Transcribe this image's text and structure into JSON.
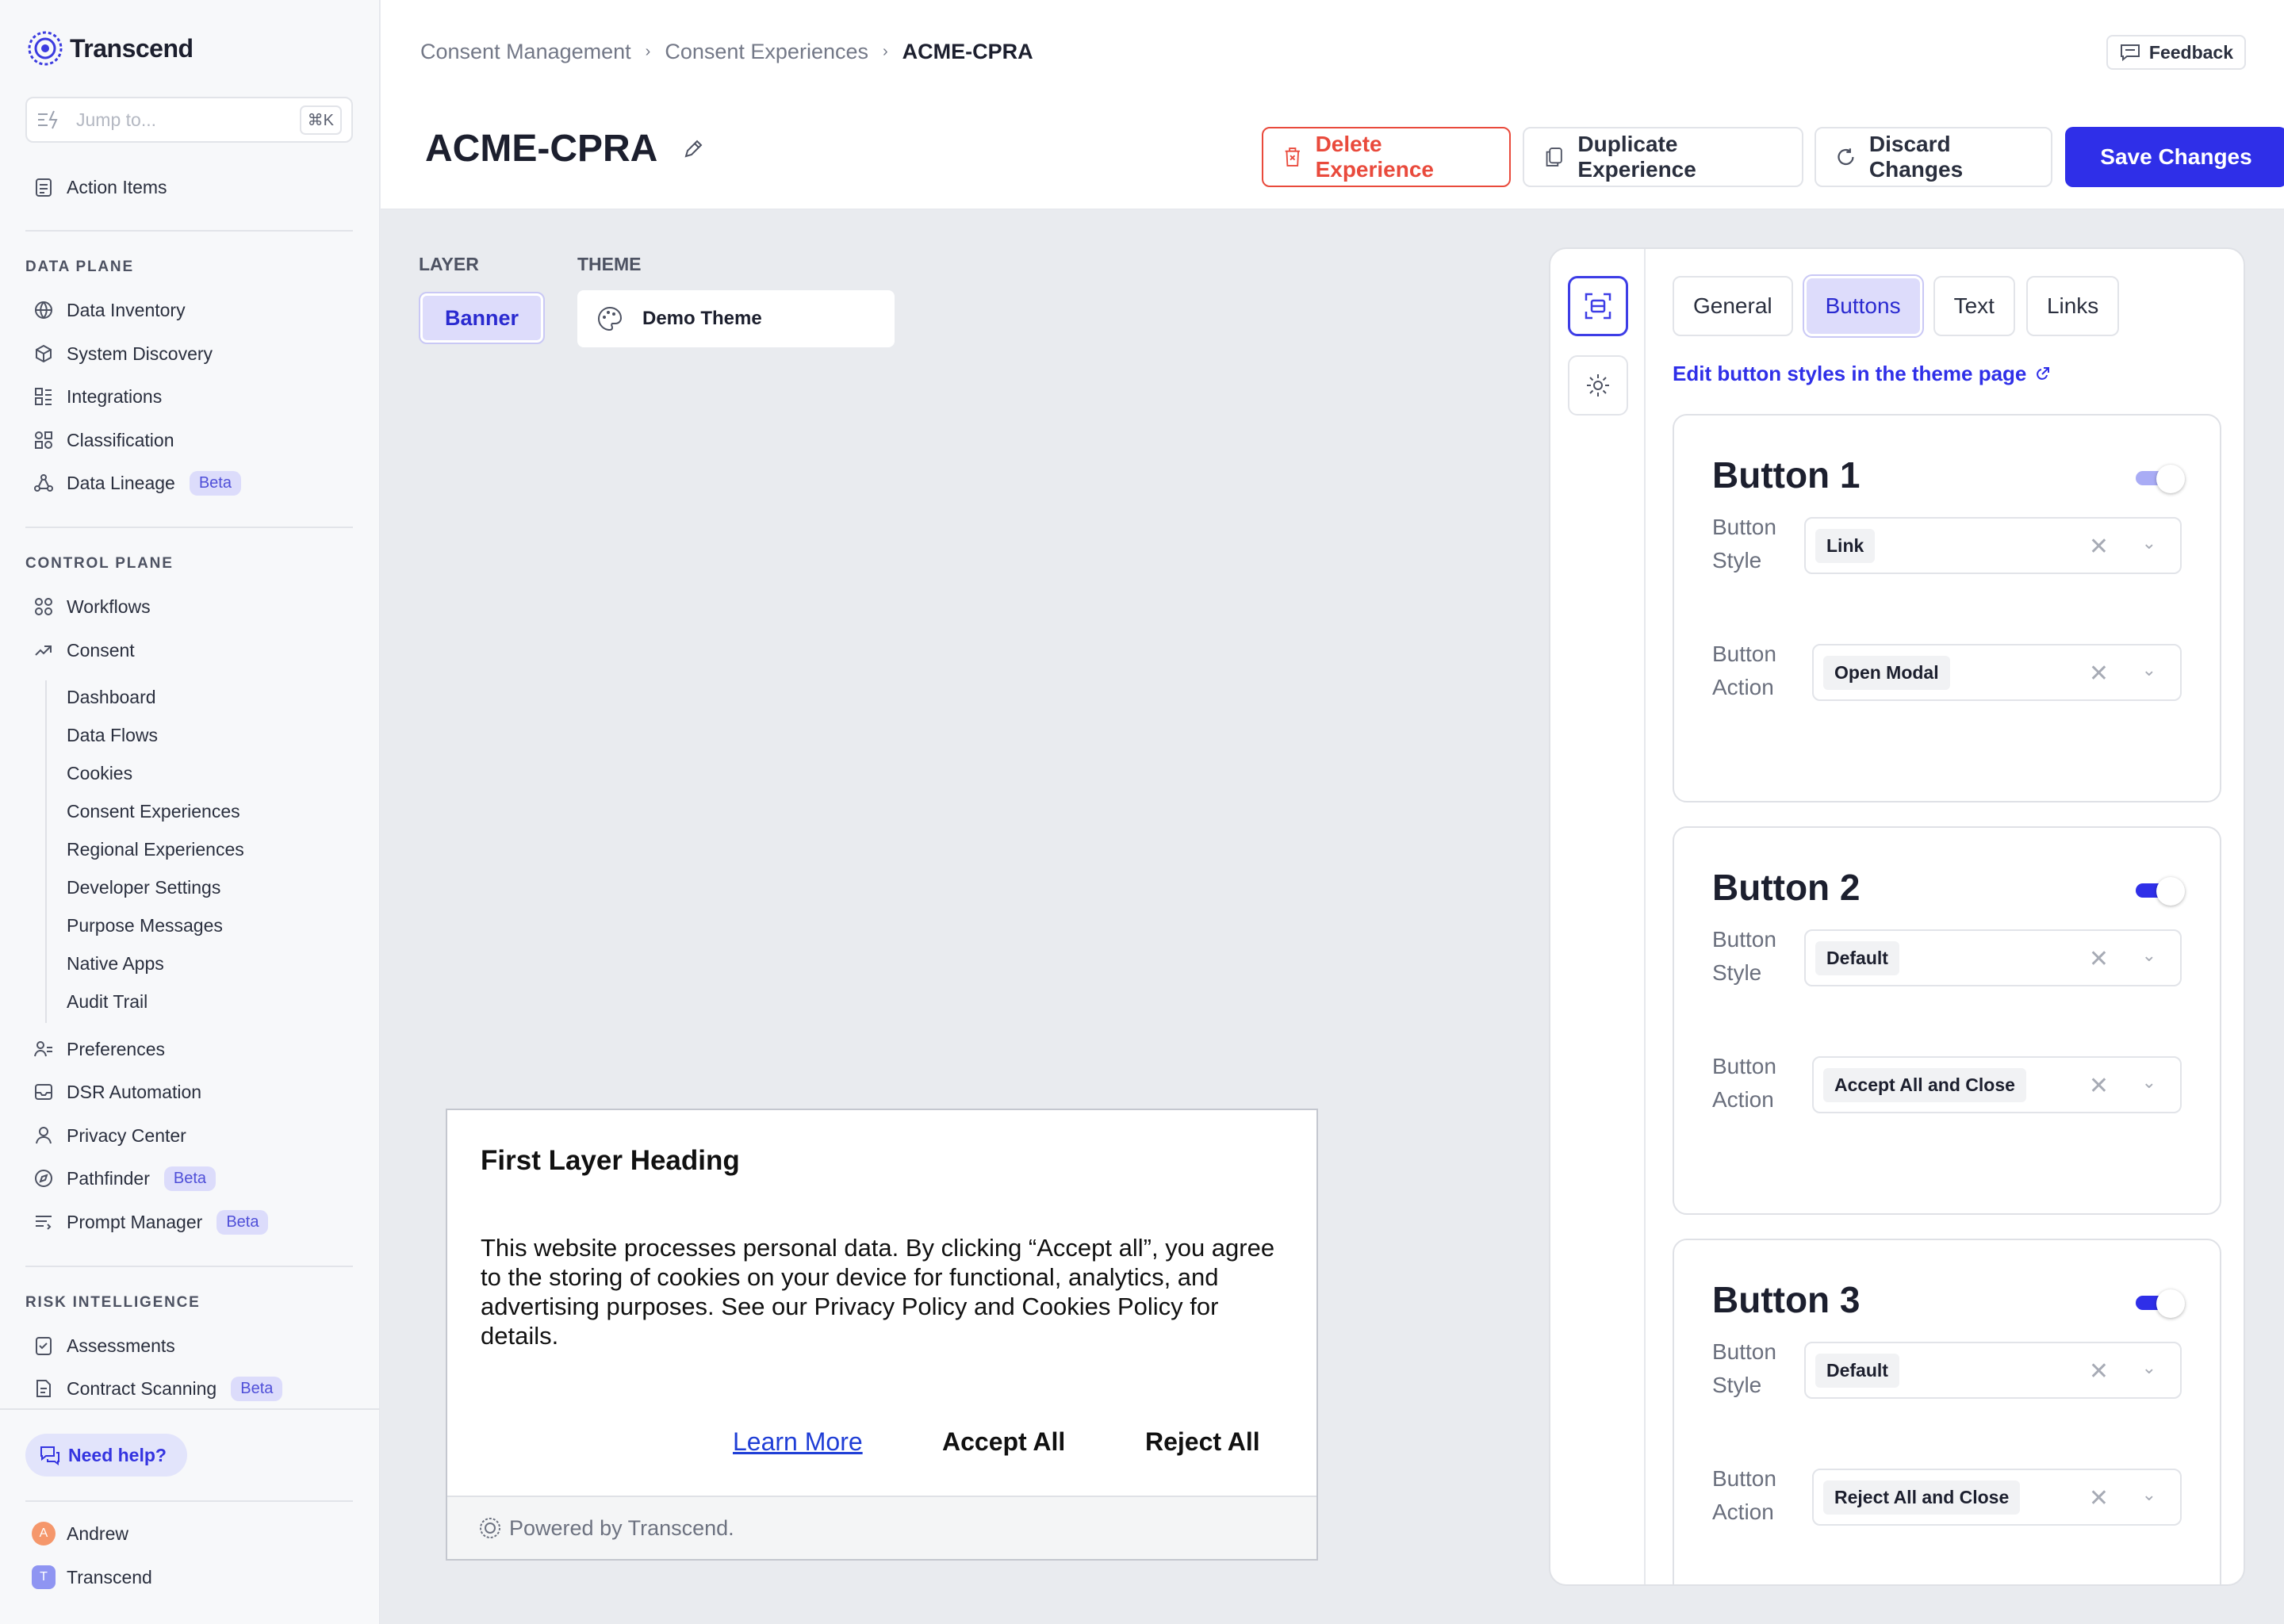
{
  "app": {
    "name": "Transcend"
  },
  "sidebar": {
    "jump_placeholder": "Jump to...",
    "jump_shortcut": "⌘K",
    "action_items": "Action Items",
    "data_plane": {
      "title": "DATA PLANE",
      "items": [
        {
          "label": "Data Inventory",
          "icon": "globe-icon"
        },
        {
          "label": "System Discovery",
          "icon": "cube-icon"
        },
        {
          "label": "Integrations",
          "icon": "integrations-icon"
        },
        {
          "label": "Classification",
          "icon": "classification-icon"
        },
        {
          "label": "Data Lineage",
          "icon": "lineage-icon",
          "badge": "Beta"
        }
      ]
    },
    "control_plane": {
      "title": "CONTROL PLANE",
      "items": [
        {
          "label": "Workflows",
          "icon": "workflows-icon"
        },
        {
          "label": "Consent",
          "icon": "consent-icon"
        }
      ],
      "consent_sub": [
        "Dashboard",
        "Data Flows",
        "Cookies",
        "Consent Experiences",
        "Regional Experiences",
        "Developer Settings",
        "Purpose Messages",
        "Native Apps",
        "Audit Trail"
      ],
      "more_items": [
        {
          "label": "Preferences",
          "icon": "preferences-icon"
        },
        {
          "label": "DSR Automation",
          "icon": "inbox-icon"
        },
        {
          "label": "Privacy Center",
          "icon": "user-icon"
        },
        {
          "label": "Pathfinder",
          "icon": "compass-icon",
          "badge": "Beta"
        },
        {
          "label": "Prompt Manager",
          "icon": "prompt-icon",
          "badge": "Beta"
        }
      ]
    },
    "risk": {
      "title": "RISK INTELLIGENCE",
      "items": [
        {
          "label": "Assessments",
          "icon": "assessments-icon"
        },
        {
          "label": "Contract Scanning",
          "icon": "contract-icon",
          "badge": "Beta"
        }
      ]
    },
    "help": "Need help?",
    "users": [
      {
        "name": "Andrew",
        "initial": "A",
        "color": "#f5976b"
      },
      {
        "name": "Transcend",
        "initial": "T",
        "color": "#8f95f2"
      }
    ]
  },
  "header": {
    "breadcrumbs": [
      "Consent Management",
      "Consent Experiences",
      "ACME-CPRA"
    ],
    "feedback": "Feedback",
    "title": "ACME-CPRA",
    "buttons": {
      "delete": "Delete Experience",
      "duplicate": "Duplicate Experience",
      "discard": "Discard Changes",
      "save": "Save Changes"
    }
  },
  "editor": {
    "layer_label": "LAYER",
    "layer_value": "Banner",
    "theme_label": "THEME",
    "theme_value": "Demo Theme"
  },
  "preview": {
    "heading": "First Layer Heading",
    "body": "This website processes personal data. By clicking “Accept all”, you agree to the storing of cookies on your device for functional, analytics, and advertising purposes. See our Privacy Policy and Cookies Policy for details.",
    "learn_more": "Learn More",
    "accept_all": "Accept All",
    "reject_all": "Reject All",
    "powered_by": "Powered by Transcend."
  },
  "panel": {
    "tabs": [
      "General",
      "Buttons",
      "Text",
      "Links"
    ],
    "active_tab": "Buttons",
    "edit_link": "Edit button styles in the theme page",
    "style_label": "Button Style",
    "action_label": "Button Action",
    "buttons": [
      {
        "title": "Button 1",
        "enabled": false,
        "style": "Link",
        "action": "Open Modal"
      },
      {
        "title": "Button 2",
        "enabled": true,
        "style": "Default",
        "action": "Accept All and Close"
      },
      {
        "title": "Button 3",
        "enabled": true,
        "style": "Default",
        "action": "Reject All and Close"
      }
    ]
  },
  "colors": {
    "accent": "#2f2fe8",
    "danger": "#e94a3c",
    "toggle_off": "#a9acf5"
  }
}
